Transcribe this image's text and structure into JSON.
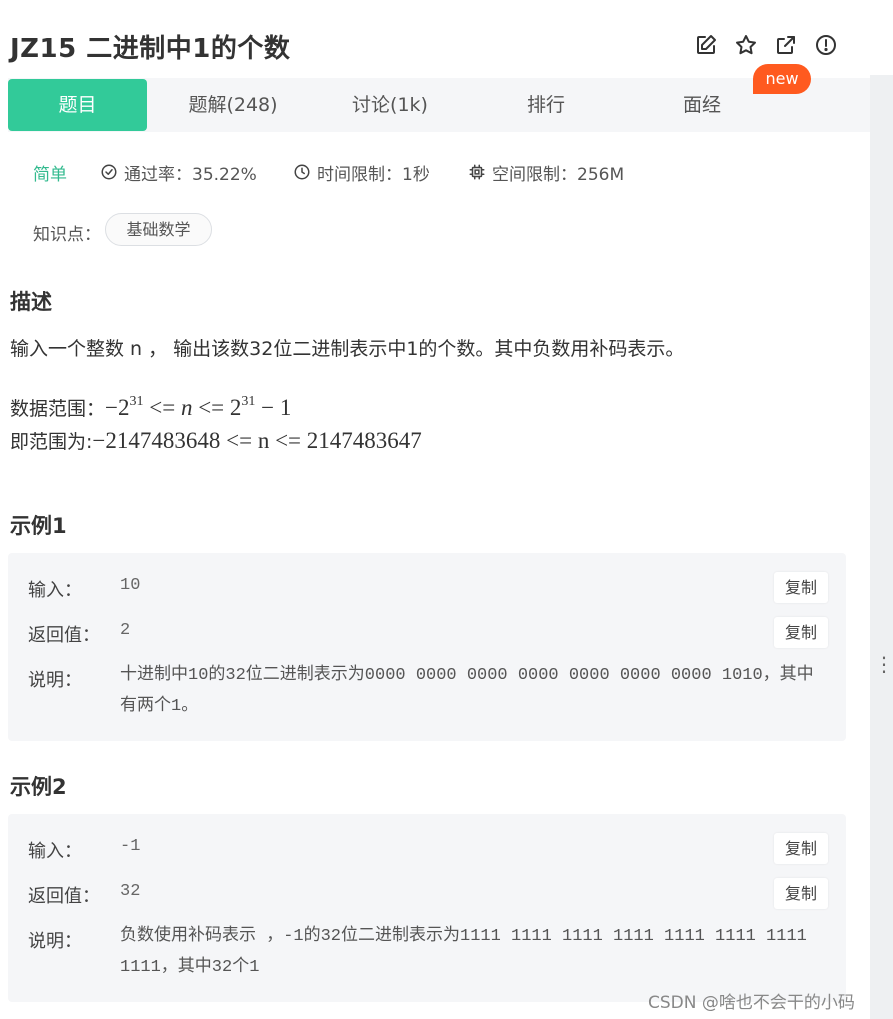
{
  "title": "JZ15  二进制中1的个数",
  "toolbar": {
    "icons": [
      "edit-icon",
      "star-icon",
      "share-icon",
      "alert-icon"
    ]
  },
  "tabs": [
    {
      "label": "题目",
      "active": true
    },
    {
      "label": "题解(248)",
      "active": false
    },
    {
      "label": "讨论(1k)",
      "active": false
    },
    {
      "label": "排行",
      "active": false
    },
    {
      "label": "面经",
      "active": false
    }
  ],
  "new_badge": "new",
  "meta": {
    "difficulty": "简单",
    "pass_rate": "通过率：35.22%",
    "time_limit": "时间限制：1秒",
    "space_limit": "空间限制：256M"
  },
  "knowledge": {
    "label": "知识点：",
    "tag": "基础数学"
  },
  "description": {
    "heading": "描述",
    "text": "输入一个整数 n ， 输出该数32位二进制表示中1的个数。其中负数用补码表示。",
    "range_label": "数据范围：",
    "range_label2": "即范围为:",
    "range_math_exp": "31",
    "range_math_value": "−2147483648 <= n <= 2147483647"
  },
  "examples": [
    {
      "heading": "示例1",
      "input_label": "输入：",
      "input": "10",
      "return_label": "返回值：",
      "return": "2",
      "explain_label": "说明：",
      "explain": "十进制中10的32位二进制表示为0000 0000 0000 0000 0000 0000 0000 1010，其中有两个1。",
      "copy_label": "复制"
    },
    {
      "heading": "示例2",
      "input_label": "输入：",
      "input": "-1",
      "return_label": "返回值：",
      "return": "32",
      "explain_label": "说明：",
      "explain": "负数使用补码表示 ，-1的32位二进制表示为1111 1111 1111 1111 1111 1111 1111 1111，其中32个1",
      "copy_label": "复制"
    }
  ],
  "watermark": "CSDN @啥也不会干的小码"
}
